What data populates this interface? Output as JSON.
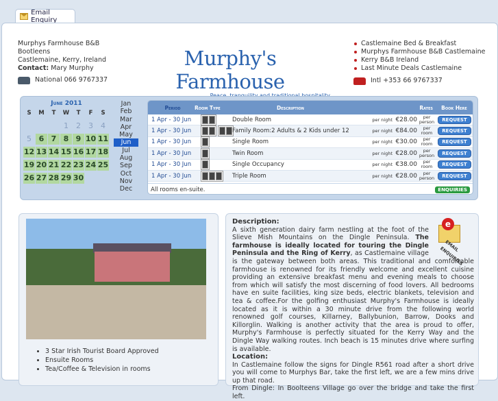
{
  "tab": {
    "label": "Email Enquiry"
  },
  "contact": {
    "name": "Murphys Farmhouse B&B",
    "address1": "Bootleens",
    "address2": "Castlemaine, Kerry, Ireland",
    "contact_label": "Contact:",
    "contact_name": "Mary Murphy",
    "national": "National 066 9767337",
    "intl": "Intl +353 66 9767337"
  },
  "logo": {
    "title": "Murphy's Farmhouse",
    "subtitle": "Peace, tranquility and traditional hospitality"
  },
  "links": [
    "Castlemaine Bed & Breakfast",
    "Murphys Farmhouse B&B Castlemaine",
    "Kerry B&B Ireland",
    "Last Minute Deals Castlemaine"
  ],
  "calendar": {
    "title": "June 2011",
    "days": [
      "S",
      "M",
      "T",
      "W",
      "T",
      "F",
      "S"
    ],
    "weeks": [
      [
        "",
        "",
        "",
        "1",
        "2",
        "3",
        "4"
      ],
      [
        "5",
        "6",
        "7",
        "8",
        "9",
        "10",
        "11"
      ],
      [
        "12",
        "13",
        "14",
        "15",
        "16",
        "17",
        "18"
      ],
      [
        "19",
        "20",
        "21",
        "22",
        "23",
        "24",
        "25"
      ],
      [
        "26",
        "27",
        "28",
        "29",
        "30",
        "",
        ""
      ]
    ],
    "months": [
      "Jan",
      "Feb",
      "Mar",
      "Apr",
      "May",
      "Jun",
      "Jul",
      "Aug",
      "Sep",
      "Oct",
      "Nov",
      "Dec"
    ],
    "selected_month": "Jun"
  },
  "rates": {
    "headers": [
      "Period",
      "Room Type",
      "Description",
      "Rates",
      "Book Here"
    ],
    "rows": [
      {
        "period": "1 Apr - 30 Jun",
        "persons": 2,
        "desc": "Double Room",
        "basis": "per night",
        "price": "€28.00",
        "unit": "per person"
      },
      {
        "period": "1 Apr - 30 Jun",
        "persons": 4,
        "desc": "Family Room:2 Adults & 2 Kids under 12",
        "basis": "per night",
        "price": "€84.00",
        "unit": "per room"
      },
      {
        "period": "1 Apr - 30 Jun",
        "persons": 1,
        "desc": "Single Room",
        "basis": "per night",
        "price": "€30.00",
        "unit": "per room"
      },
      {
        "period": "1 Apr - 30 Jun",
        "persons": 1,
        "desc": "Twin Room",
        "basis": "per night",
        "price": "€28.00",
        "unit": "per person"
      },
      {
        "period": "1 Apr - 30 Jun",
        "persons": 1,
        "desc": "Single Occupancy",
        "basis": "per night",
        "price": "€38.00",
        "unit": "per room"
      },
      {
        "period": "1 Apr - 30 Jun",
        "persons": 3,
        "desc": "Triple Room",
        "basis": "per night",
        "price": "€28.00",
        "unit": "per person"
      }
    ],
    "request_label": "REQUEST",
    "footer": "All rooms en-suite.",
    "enquiries_label": "ENQUIRIES"
  },
  "features": [
    "3 Star Irish Tourist Board Approved",
    "Ensuite Rooms",
    "Tea/Coffee & Television in rooms"
  ],
  "email_badge": {
    "letter": "e",
    "text": "EMAIL ENQUIRIES"
  },
  "description": {
    "heading": "Description:",
    "p1": "A sixth generation dairy farm nestling at the foot of the Slieve Mish Mountains on the Dingle Peninsula.",
    "p1_bold": "The farmhouse is ideally located for touring the Dingle Peninsula and the Ring of Kerry",
    "p2": ", as Castlemaine village is the gateway between both areas. This traditional and comfortable farmhouse is renowned for its friendly welcome and excellent cuisine providing an extensive breakfast menu and evening meals to choose from which will satisfy the most discerning of food lovers. All bedrooms have en suite facilities, king size beds, electric blankets, television and tea & coffee.For the golfing enthusiast Murphy's Farmhouse is ideally located as it is within a 30 minute drive from the following world renowned golf courses, Killarney, Ballybunion, Barrow, Dooks and Killorglin. Walking is another activity that the area is proud to offer, Murphy's Farmhouse is perfectly situated for the Kerry Way and the Dingle Way walking routes. Inch beach is 15 minutes drive where surfing is available.",
    "loc_heading": "Location:",
    "loc1": "In Castlemaine follow the signs for Dingle R561 road after a short drive you will come to Murphys Bar, take the first left, we are a few mins drive up that road.",
    "loc2": "From Dingle: In Boolteens Village go over the bridge and take the first left."
  }
}
